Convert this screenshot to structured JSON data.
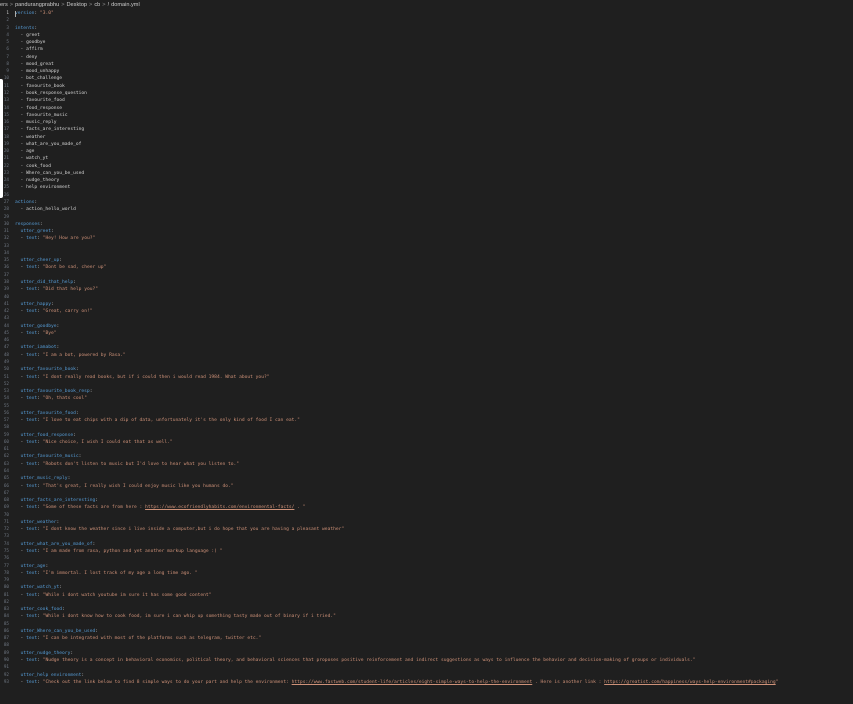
{
  "breadcrumb": {
    "items": [
      "ers",
      "pandurangprabhu",
      "Desktop",
      "cb"
    ],
    "file_icon": "!",
    "file_name": "domain.yml",
    "separator": ">"
  },
  "editor": {
    "active_line": 1,
    "lines": [
      [
        [
          "k",
          "version"
        ],
        [
          "p",
          ": "
        ],
        [
          "s",
          "\"3.0\""
        ]
      ],
      [],
      [
        [
          "k",
          "intents"
        ],
        [
          "p",
          ":"
        ]
      ],
      [
        [
          "d",
          "  - greet"
        ]
      ],
      [
        [
          "d",
          "  - goodbye"
        ]
      ],
      [
        [
          "d",
          "  - affirm"
        ]
      ],
      [
        [
          "d",
          "  - deny"
        ]
      ],
      [
        [
          "d",
          "  - mood_great"
        ]
      ],
      [
        [
          "d",
          "  - mood_unhappy"
        ]
      ],
      [
        [
          "d",
          "  - bot_challenge"
        ]
      ],
      [
        [
          "d",
          "  - favourite_book"
        ]
      ],
      [
        [
          "d",
          "  - book_response_question"
        ]
      ],
      [
        [
          "d",
          "  - favourite_food"
        ]
      ],
      [
        [
          "d",
          "  - food_response"
        ]
      ],
      [
        [
          "d",
          "  - favourite_music"
        ]
      ],
      [
        [
          "d",
          "  - music_reply"
        ]
      ],
      [
        [
          "d",
          "  - facts_are_interesting"
        ]
      ],
      [
        [
          "d",
          "  - weather"
        ]
      ],
      [
        [
          "d",
          "  - what_are_you_made_of"
        ]
      ],
      [
        [
          "d",
          "  - age"
        ]
      ],
      [
        [
          "d",
          "  - watch_yt"
        ]
      ],
      [
        [
          "d",
          "  - cook_food"
        ]
      ],
      [
        [
          "d",
          "  - Where_can_you_be_used"
        ]
      ],
      [
        [
          "d",
          "  - nudge_theory"
        ]
      ],
      [
        [
          "d",
          "  - help environment"
        ]
      ],
      [],
      [
        [
          "k",
          "actions"
        ],
        [
          "p",
          ":"
        ]
      ],
      [
        [
          "d",
          "  - action_hello_world"
        ]
      ],
      [],
      [
        [
          "k",
          "responses"
        ],
        [
          "p",
          ":"
        ]
      ],
      [
        [
          "d",
          "  "
        ],
        [
          "k",
          "utter_greet"
        ],
        [
          "p",
          ":"
        ]
      ],
      [
        [
          "d",
          "  - "
        ],
        [
          "k",
          "text"
        ],
        [
          "p",
          ": "
        ],
        [
          "s",
          "\"Hey! How are you?\""
        ]
      ],
      [],
      [],
      [
        [
          "d",
          "  "
        ],
        [
          "k",
          "utter_cheer_up"
        ],
        [
          "p",
          ":"
        ]
      ],
      [
        [
          "d",
          "  - "
        ],
        [
          "k",
          "text"
        ],
        [
          "p",
          ": "
        ],
        [
          "s",
          "\"Dont be sad, cheer up\""
        ]
      ],
      [],
      [
        [
          "d",
          "  "
        ],
        [
          "k",
          "utter_did_that_help"
        ],
        [
          "p",
          ":"
        ]
      ],
      [
        [
          "d",
          "  - "
        ],
        [
          "k",
          "text"
        ],
        [
          "p",
          ": "
        ],
        [
          "s",
          "\"Did that help you?\""
        ]
      ],
      [],
      [
        [
          "d",
          "  "
        ],
        [
          "k",
          "utter_happy"
        ],
        [
          "p",
          ":"
        ]
      ],
      [
        [
          "d",
          "  - "
        ],
        [
          "k",
          "text"
        ],
        [
          "p",
          ": "
        ],
        [
          "s",
          "\"Great, carry on!\""
        ]
      ],
      [],
      [
        [
          "d",
          "  "
        ],
        [
          "k",
          "utter_goodbye"
        ],
        [
          "p",
          ":"
        ]
      ],
      [
        [
          "d",
          "  - "
        ],
        [
          "k",
          "text"
        ],
        [
          "p",
          ": "
        ],
        [
          "s",
          "\"Bye\""
        ]
      ],
      [],
      [
        [
          "d",
          "  "
        ],
        [
          "k",
          "utter_iamabot"
        ],
        [
          "p",
          ":"
        ]
      ],
      [
        [
          "d",
          "  - "
        ],
        [
          "k",
          "text"
        ],
        [
          "p",
          ": "
        ],
        [
          "s",
          "\"I am a bot, powered by Rasa.\""
        ]
      ],
      [],
      [
        [
          "d",
          "  "
        ],
        [
          "k",
          "utter_favourite_book"
        ],
        [
          "p",
          ":"
        ]
      ],
      [
        [
          "d",
          "  - "
        ],
        [
          "k",
          "text"
        ],
        [
          "p",
          ": "
        ],
        [
          "s",
          "\"I dont really read books, but if i could then i would read 1984. What about you?\""
        ]
      ],
      [],
      [
        [
          "d",
          "  "
        ],
        [
          "k",
          "utter_favourite_book_resp"
        ],
        [
          "p",
          ":"
        ]
      ],
      [
        [
          "d",
          "  - "
        ],
        [
          "k",
          "text"
        ],
        [
          "p",
          ": "
        ],
        [
          "s",
          "\"Oh, thats cool\""
        ]
      ],
      [],
      [
        [
          "d",
          "  "
        ],
        [
          "k",
          "utter_favourite_food"
        ],
        [
          "p",
          ":"
        ]
      ],
      [
        [
          "d",
          "  - "
        ],
        [
          "k",
          "text"
        ],
        [
          "p",
          ": "
        ],
        [
          "s",
          "\"I love to eat chips with a dip of data, unfortunately it's the only kind of food I can eat.\""
        ]
      ],
      [],
      [
        [
          "d",
          "  "
        ],
        [
          "k",
          "utter_food_response"
        ],
        [
          "p",
          ":"
        ]
      ],
      [
        [
          "d",
          "  - "
        ],
        [
          "k",
          "text"
        ],
        [
          "p",
          ": "
        ],
        [
          "s",
          "\"Nice choice, I wish I could eat that as well.\""
        ]
      ],
      [],
      [
        [
          "d",
          "  "
        ],
        [
          "k",
          "utter_favourite_music"
        ],
        [
          "p",
          ":"
        ]
      ],
      [
        [
          "d",
          "  - "
        ],
        [
          "k",
          "text"
        ],
        [
          "p",
          ": "
        ],
        [
          "s",
          "\"Robots don't listen to music but I'd love to hear what you listen to.\""
        ]
      ],
      [],
      [
        [
          "d",
          "  "
        ],
        [
          "k",
          "utter_music_reply"
        ],
        [
          "p",
          ":"
        ]
      ],
      [
        [
          "d",
          "  - "
        ],
        [
          "k",
          "text"
        ],
        [
          "p",
          ": "
        ],
        [
          "s",
          "\"That's great, I really wish I could enjoy music like you humans do.\""
        ]
      ],
      [],
      [
        [
          "d",
          "  "
        ],
        [
          "k",
          "utter_facts_are_interesting"
        ],
        [
          "p",
          ":"
        ]
      ],
      [
        [
          "d",
          "  - "
        ],
        [
          "k",
          "text"
        ],
        [
          "p",
          ": "
        ],
        [
          "s",
          "\"Some of these facts are from here : "
        ],
        [
          "u",
          "https://www.ecofriendlyhabits.com/environmental-facts/"
        ],
        [
          "s",
          " . \""
        ]
      ],
      [],
      [
        [
          "d",
          "  "
        ],
        [
          "k",
          "utter_weather"
        ],
        [
          "p",
          ":"
        ]
      ],
      [
        [
          "d",
          "  - "
        ],
        [
          "k",
          "text"
        ],
        [
          "p",
          ": "
        ],
        [
          "s",
          "\"I dont know the weather since i live inside a computer,but i do hope that you are having a pleasant weather\""
        ]
      ],
      [],
      [
        [
          "d",
          "  "
        ],
        [
          "k",
          "utter_what_are_you_made_of"
        ],
        [
          "p",
          ":"
        ]
      ],
      [
        [
          "d",
          "  - "
        ],
        [
          "k",
          "text"
        ],
        [
          "p",
          ": "
        ],
        [
          "s",
          "\"I am made from rasa, python and yet another markup language :) \""
        ]
      ],
      [],
      [
        [
          "d",
          "  "
        ],
        [
          "k",
          "utter_age"
        ],
        [
          "p",
          ":"
        ]
      ],
      [
        [
          "d",
          "  - "
        ],
        [
          "k",
          "text"
        ],
        [
          "p",
          ": "
        ],
        [
          "s",
          "\"I'm immortal. I lost track of my age a long time ago. \""
        ]
      ],
      [],
      [
        [
          "d",
          "  "
        ],
        [
          "k",
          "utter_watch_yt"
        ],
        [
          "p",
          ":"
        ]
      ],
      [
        [
          "d",
          "  - "
        ],
        [
          "k",
          "text"
        ],
        [
          "p",
          ": "
        ],
        [
          "s",
          "\"While i dont watch youtube im sure it has some good content\""
        ]
      ],
      [],
      [
        [
          "d",
          "  "
        ],
        [
          "k",
          "utter_cook_food"
        ],
        [
          "p",
          ":"
        ]
      ],
      [
        [
          "d",
          "  - "
        ],
        [
          "k",
          "text"
        ],
        [
          "p",
          ": "
        ],
        [
          "s",
          "\"While i dont know how to cook food, im sure i can whip up something tasty made out of binary if i tried.\""
        ]
      ],
      [],
      [
        [
          "d",
          "  "
        ],
        [
          "k",
          "utter_Where_can_you_be_used"
        ],
        [
          "p",
          ":"
        ]
      ],
      [
        [
          "d",
          "  - "
        ],
        [
          "k",
          "text"
        ],
        [
          "p",
          ": "
        ],
        [
          "s",
          "\"I can be integrated with most of the platforms such as telegram, twitter etc.\""
        ]
      ],
      [],
      [
        [
          "d",
          "  "
        ],
        [
          "k",
          "utter_nudge_theory"
        ],
        [
          "p",
          ":"
        ]
      ],
      [
        [
          "d",
          "  - "
        ],
        [
          "k",
          "text"
        ],
        [
          "p",
          ": "
        ],
        [
          "s",
          "\"Nudge theory is a concept in behavioral economics, political theory, and behavioral sciences that proposes positive reinforcement and indirect suggestions as ways to influence the behavior and decision-making of groups or individuals.\""
        ]
      ],
      [],
      [
        [
          "d",
          "  "
        ],
        [
          "k",
          "utter_help environment"
        ],
        [
          "p",
          ":"
        ]
      ],
      [
        [
          "d",
          "  - "
        ],
        [
          "k",
          "text"
        ],
        [
          "p",
          ": "
        ],
        [
          "s",
          "\"Check out the link below to find 8 simple ways to do your part and help the environment: "
        ],
        [
          "u",
          "https://www.fastweb.com/student-life/articles/eight-simple-ways-to-help-the-environment"
        ],
        [
          "s",
          " . Here is another link : "
        ],
        [
          "u",
          "https://greatist.com/happiness/ways-help-environment#packaging"
        ],
        [
          "s",
          "\""
        ]
      ]
    ]
  }
}
